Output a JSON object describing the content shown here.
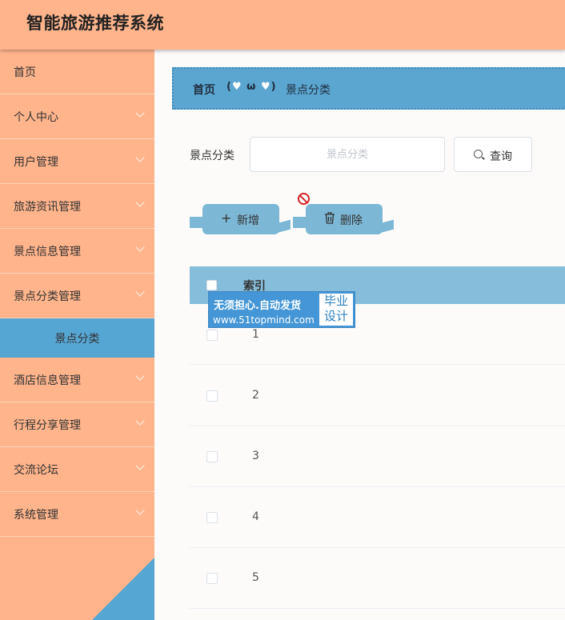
{
  "app": {
    "title": "智能旅游推荐系统"
  },
  "sidebar": {
    "items": [
      {
        "label": "首页",
        "has_arrow": false
      },
      {
        "label": "个人中心",
        "has_arrow": true
      },
      {
        "label": "用户管理",
        "has_arrow": true
      },
      {
        "label": "旅游资讯管理",
        "has_arrow": true
      },
      {
        "label": "景点信息管理",
        "has_arrow": true
      },
      {
        "label": "景点分类管理",
        "has_arrow": true
      },
      {
        "label": "酒店信息管理",
        "has_arrow": true
      },
      {
        "label": "行程分享管理",
        "has_arrow": true
      },
      {
        "label": "交流论坛",
        "has_arrow": true
      },
      {
        "label": "系统管理",
        "has_arrow": true
      }
    ],
    "active_sub": {
      "label": "景点分类"
    }
  },
  "breadcrumb": {
    "home": "首页",
    "separator_left": "(",
    "separator_mid": "ω",
    "separator_right": ")",
    "heart": "♥",
    "current": "景点分类"
  },
  "search": {
    "label": "景点分类",
    "placeholder": "景点分类",
    "value": "",
    "button": "查询"
  },
  "actions": {
    "add": "新增",
    "add_icon": "+",
    "delete": "删除",
    "delete_icon": "trash-icon"
  },
  "table": {
    "columns": [
      "索引"
    ],
    "rows": [
      {
        "index": "1"
      },
      {
        "index": "2"
      },
      {
        "index": "3"
      },
      {
        "index": "4"
      },
      {
        "index": "5"
      }
    ]
  },
  "watermark": {
    "line1": "无须担心.自动发货",
    "line2": "www.51topmind.com",
    "badge_top": "毕业",
    "badge_bottom": "设计"
  },
  "colors": {
    "header_bg": "#ffb48c",
    "sidebar_active": "#56a6d4",
    "breadcrumb_bg": "#5ba6d1",
    "button_bg": "#7cb7d6",
    "table_head_bg": "#86bddb"
  }
}
